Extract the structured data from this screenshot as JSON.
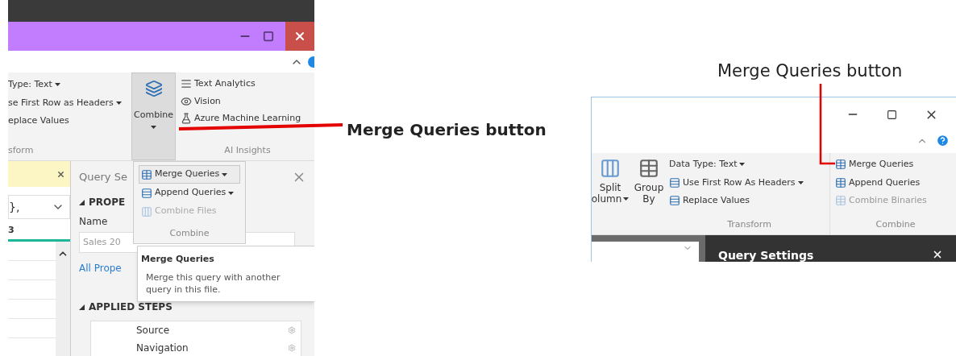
{
  "left_screenshot": {
    "ribbon": {
      "transform_items": [
        {
          "label": "Type: Text",
          "has_menu": true
        },
        {
          "label": "se First Row as Headers",
          "has_menu": true
        },
        {
          "label": "eplace Values",
          "has_menu": false
        }
      ],
      "transform_group": "sform",
      "combine_button": {
        "label": "Combine",
        "expanded": true
      },
      "ai_items": [
        "Text Analytics",
        "Vision",
        "Azure Machine Learning"
      ],
      "ai_group": "AI Insights"
    },
    "left_pane": {
      "formula": "},",
      "column": "3"
    },
    "query_settings": {
      "title": "Query Se",
      "properties": "PROPE",
      "name_label": "Name",
      "name_value": "Sales 20",
      "link": "All Prope",
      "steps_title": "APPLIED STEPS",
      "steps": [
        "Source",
        "Navigation"
      ]
    },
    "combine_menu": {
      "items": [
        {
          "label": "Merge Queries",
          "has_menu": true,
          "disabled": false,
          "selected": true
        },
        {
          "label": "Append Queries",
          "has_menu": true,
          "disabled": false,
          "selected": false
        },
        {
          "label": "Combine Files",
          "has_menu": false,
          "disabled": true,
          "selected": false
        }
      ],
      "group": "Combine"
    },
    "tooltip": {
      "title": "Merge Queries",
      "text": "Merge this query with another query in this file."
    }
  },
  "right_screenshot": {
    "split": [
      "Split",
      "olumn"
    ],
    "group_by": "Group By",
    "transform_items": [
      {
        "label": "Data Type: Text",
        "has_menu": true
      },
      {
        "label": "Use First Row As Headers",
        "has_menu": true
      },
      {
        "label": "Replace Values",
        "has_menu": false
      }
    ],
    "transform_group": "Transform",
    "combine_items": [
      {
        "label": "Merge Queries",
        "disabled": false
      },
      {
        "label": "Append Queries",
        "disabled": false
      },
      {
        "label": "Combine Binaries",
        "disabled": true
      }
    ],
    "combine_group": "Combine",
    "query_settings": "Query Settings"
  },
  "callouts": [
    "Merge Queries button",
    "Merge Queries button"
  ]
}
